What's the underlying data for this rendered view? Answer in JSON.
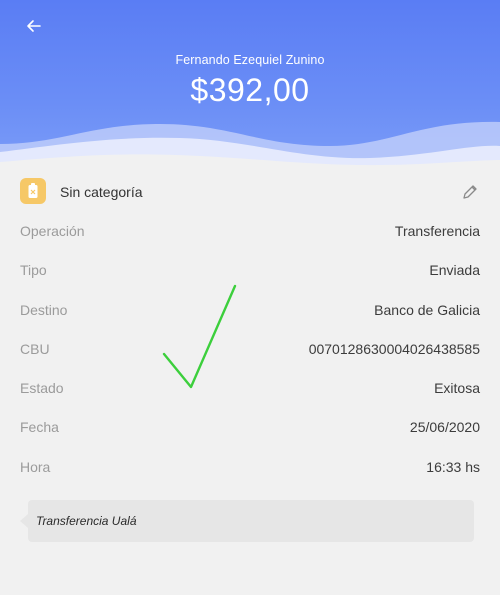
{
  "header": {
    "back_icon": "back-arrow-icon",
    "payee_name": "Fernando Ezequiel Zunino",
    "amount": "$392,00",
    "colors": {
      "gradient_top": "#5a7df4",
      "gradient_bottom": "#7c9df8"
    }
  },
  "category": {
    "icon": "tag-icon",
    "label": "Sin categoría",
    "edit_icon": "pencil-icon",
    "icon_color": "#f6c867"
  },
  "details": [
    {
      "label": "Operación",
      "value": "Transferencia"
    },
    {
      "label": "Tipo",
      "value": "Enviada"
    },
    {
      "label": "Destino",
      "value": "Banco de Galicia"
    },
    {
      "label": "CBU",
      "value": "0070128630004026438585"
    },
    {
      "label": "Estado",
      "value": "Exitosa"
    },
    {
      "label": "Fecha",
      "value": "25/06/2020"
    },
    {
      "label": "Hora",
      "value": "16:33 hs"
    }
  ],
  "overlay": {
    "icon": "check-mark-icon",
    "color": "#3ccf3c"
  },
  "note": {
    "text": "Transferencia Ualá"
  }
}
